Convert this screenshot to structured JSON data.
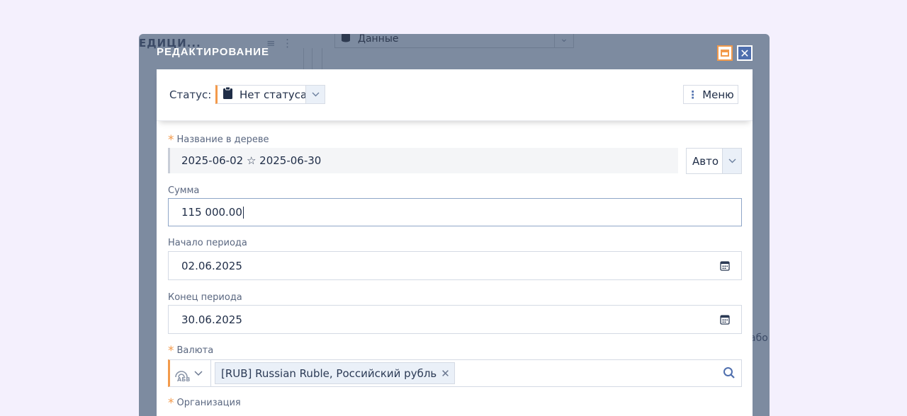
{
  "background": {
    "title": "ЕДИЦИ...",
    "select_value": "Данные",
    "right_text": "або"
  },
  "dialog": {
    "title": "РЕДАКТИРОВАНИЕ"
  },
  "status": {
    "label": "Статус:",
    "value": "Нет статуса",
    "menu_label": "Меню"
  },
  "fields": {
    "tree_name": {
      "label": "Название в дереве",
      "value": "2025-06-02 ☆ 2025-06-30",
      "mode": "Авто"
    },
    "amount": {
      "label": "Сумма",
      "value": "115 000.00"
    },
    "period_start": {
      "label": "Начало периода",
      "value": "02.06.2025"
    },
    "period_end": {
      "label": "Конец периода",
      "value": "30.06.2025"
    },
    "currency": {
      "label": "Валюта",
      "switch_text": "АБВ",
      "tag": "[RUB] Russian Ruble, Российский рубль"
    },
    "organization": {
      "label": "Организация"
    }
  },
  "colors": {
    "accent": "#f39a4b",
    "overlay": "#7d8ba0",
    "text": "#1f2d47"
  }
}
